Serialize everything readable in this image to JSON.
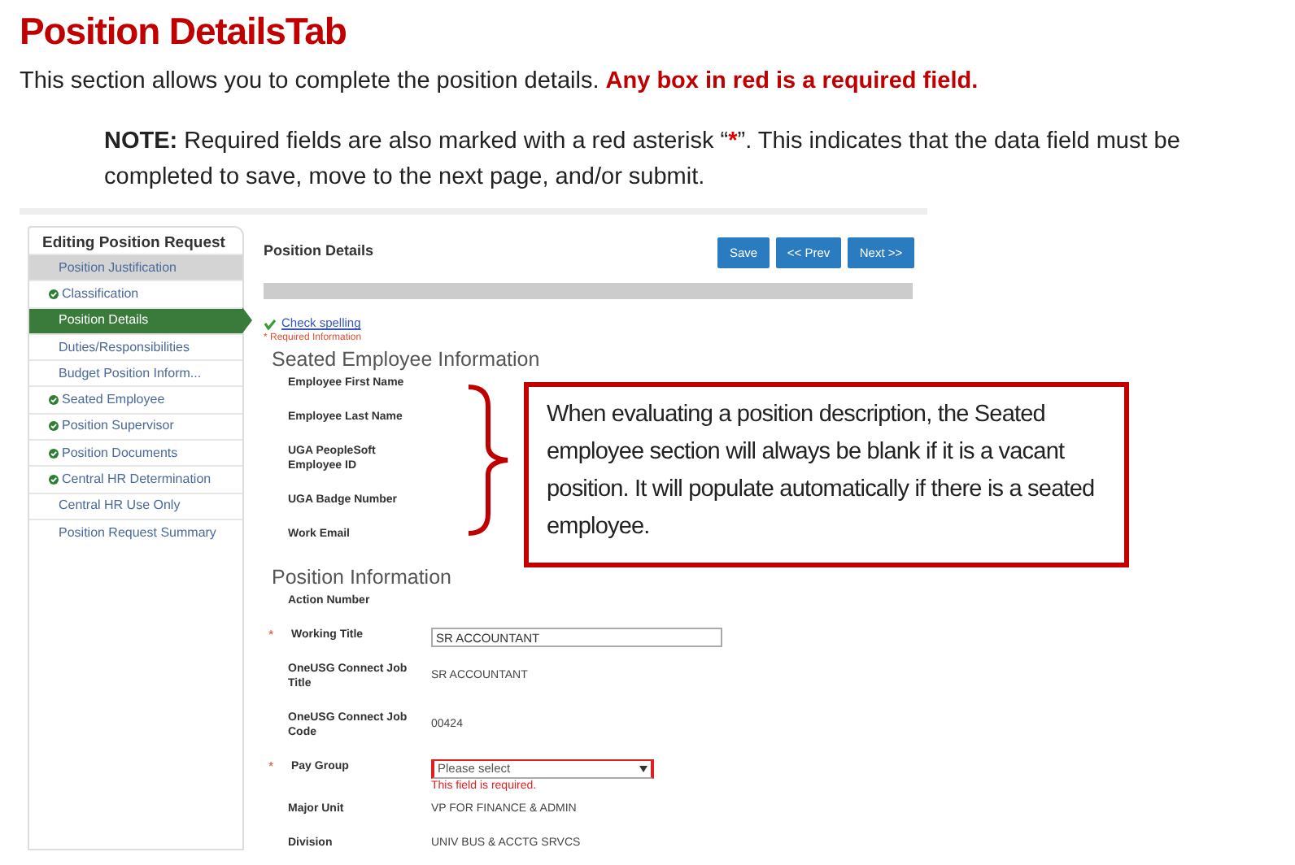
{
  "heading": "Position DetailsTab",
  "intro": {
    "text": "This section allows you to complete the position details.",
    "emphasis": "Any box in red is a required field."
  },
  "note": {
    "label": "NOTE:",
    "before": "Required fields are also marked with a red asterisk “",
    "mark": "*",
    "after": "”. This indicates that the data field must be completed to save, move to the next page, and/or submit."
  },
  "sidebar": {
    "title": "Editing Position Request",
    "items": [
      {
        "label": "Position Justification",
        "complete": false,
        "selected": false,
        "highlighted": true
      },
      {
        "label": "Classification",
        "complete": true,
        "selected": false,
        "highlighted": false
      },
      {
        "label": "Position Details",
        "complete": false,
        "selected": true,
        "highlighted": false
      },
      {
        "label": "Duties/Responsibilities",
        "complete": false,
        "selected": false,
        "highlighted": false
      },
      {
        "label": "Budget Position Inform...",
        "complete": false,
        "selected": false,
        "highlighted": false
      },
      {
        "label": "Seated Employee",
        "complete": true,
        "selected": false,
        "highlighted": false
      },
      {
        "label": "Position Supervisor",
        "complete": true,
        "selected": false,
        "highlighted": false
      },
      {
        "label": "Position Documents",
        "complete": true,
        "selected": false,
        "highlighted": false
      },
      {
        "label": "Central HR Determination",
        "complete": true,
        "selected": false,
        "highlighted": false
      },
      {
        "label": "Central HR Use Only",
        "complete": false,
        "selected": false,
        "highlighted": false
      },
      {
        "label": "Position Request Summary",
        "complete": false,
        "selected": false,
        "highlighted": false
      }
    ]
  },
  "page_title": "Position Details",
  "buttons": [
    "Save",
    "<< Prev",
    "Next >>"
  ],
  "check_spelling": "Check spelling",
  "required_info": "* Required Information",
  "seated": {
    "title": "Seated Employee Information",
    "fields": [
      {
        "label": "Employee First Name"
      },
      {
        "label": "Employee Last Name"
      },
      {
        "label": "UGA PeopleSoft Employee ID"
      },
      {
        "label": "UGA Badge Number"
      },
      {
        "label": "Work Email"
      }
    ]
  },
  "callout": "When evaluating a position description, the Seated employee section will always be blank if it is a vacant position. It will populate automatically if there is a seated employee.",
  "position": {
    "title": "Position Information",
    "fields": [
      {
        "label": "Action Number",
        "kind": "static",
        "required": false
      },
      {
        "label": "Working Title",
        "kind": "input",
        "required": true,
        "value": "SR ACCOUNTANT"
      },
      {
        "label": "OneUSG Connect Job Title",
        "kind": "static",
        "required": false,
        "value": "SR ACCOUNTANT"
      },
      {
        "label": "OneUSG Connect Job Code",
        "kind": "static",
        "required": false,
        "value": "00424"
      },
      {
        "label": "Pay Group",
        "kind": "select",
        "required": true,
        "value": "Please select",
        "error": "This field is required."
      },
      {
        "label": "Major Unit",
        "kind": "static",
        "required": false,
        "value": "VP FOR FINANCE & ADMIN"
      },
      {
        "label": "Division",
        "kind": "static",
        "required": false,
        "value": "UNIV BUS & ACCTG SRVCS"
      }
    ]
  }
}
